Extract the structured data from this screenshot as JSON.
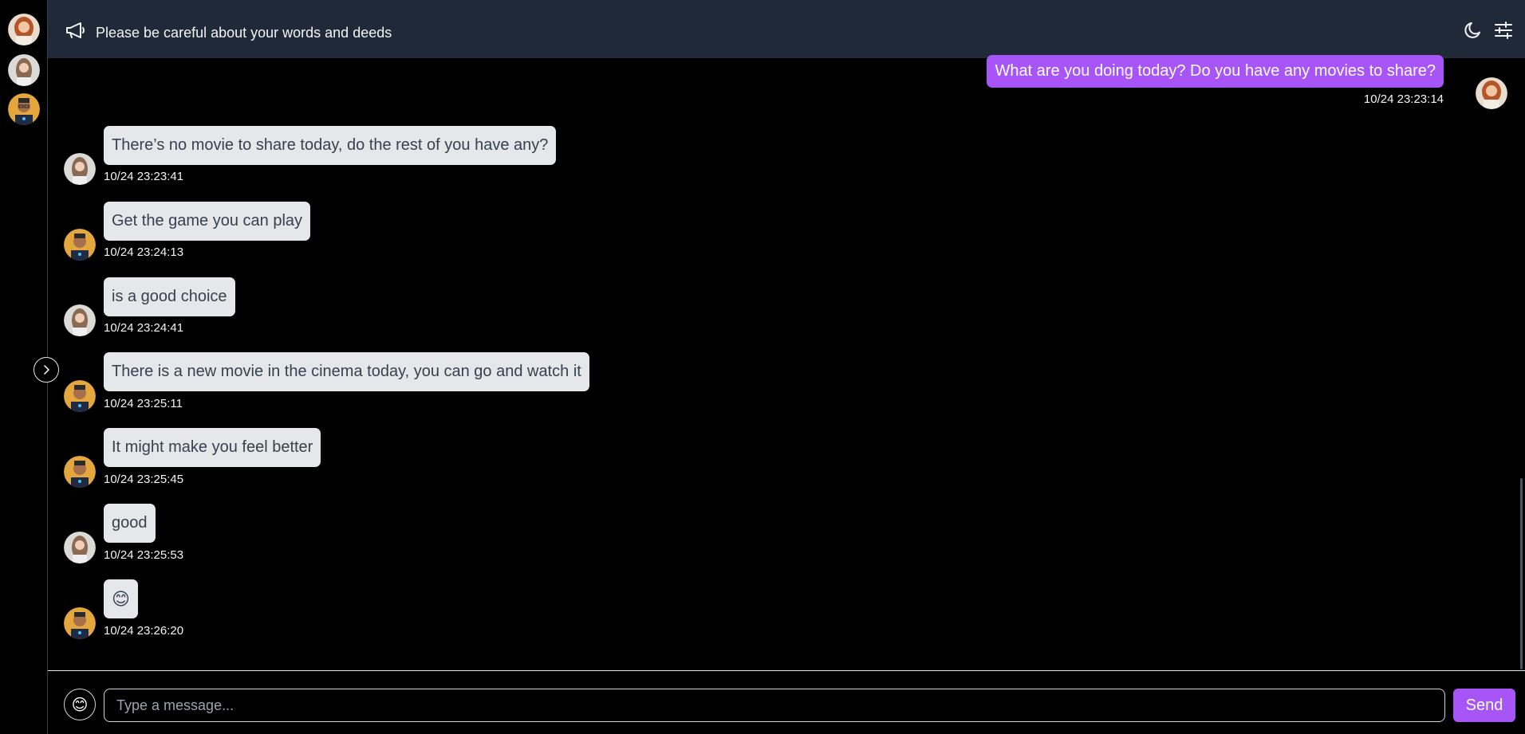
{
  "header": {
    "ghost_text": "Please be careful about your words and deeds",
    "notice": "Please be careful about your words and deeds",
    "icons": {
      "announce": "megaphone-icon",
      "theme": "moon-icon",
      "settings": "sliders-icon"
    }
  },
  "sidebar": {
    "avatars": [
      "avatar-woman-redhair",
      "avatar-woman-brunette",
      "avatar-man-glasses"
    ],
    "expand_icon": "chevron-right-icon"
  },
  "messages": [
    {
      "direction": "out",
      "text": "What are you doing today? Do you have any movies to share?",
      "time": "10/24 23:23:14"
    },
    {
      "direction": "in",
      "text": "There’s no movie to share today, do the rest of you have any?",
      "time": "10/24 23:23:41"
    },
    {
      "direction": "in",
      "text": "Get the game you can play",
      "time": "10/24 23:24:13"
    },
    {
      "direction": "in",
      "text": "is a good choice",
      "time": "10/24 23:24:41"
    },
    {
      "direction": "in",
      "text": "There is a new movie in the cinema today, you can go and watch it",
      "time": "10/24 23:25:11"
    },
    {
      "direction": "in",
      "text": "It might make you feel better",
      "time": "10/24 23:25:45"
    },
    {
      "direction": "in",
      "text": "good",
      "time": "10/24 23:25:53"
    },
    {
      "direction": "in",
      "text": "😊",
      "time": "10/24 23:26:20"
    }
  ],
  "composer": {
    "emoji": "😊",
    "placeholder": "Type a message...",
    "value": "",
    "send_label": "Send"
  },
  "colors": {
    "accent": "#a855f7",
    "header_bg": "#1f2937",
    "bubble_in": "#e5e7eb",
    "background": "#000000"
  }
}
